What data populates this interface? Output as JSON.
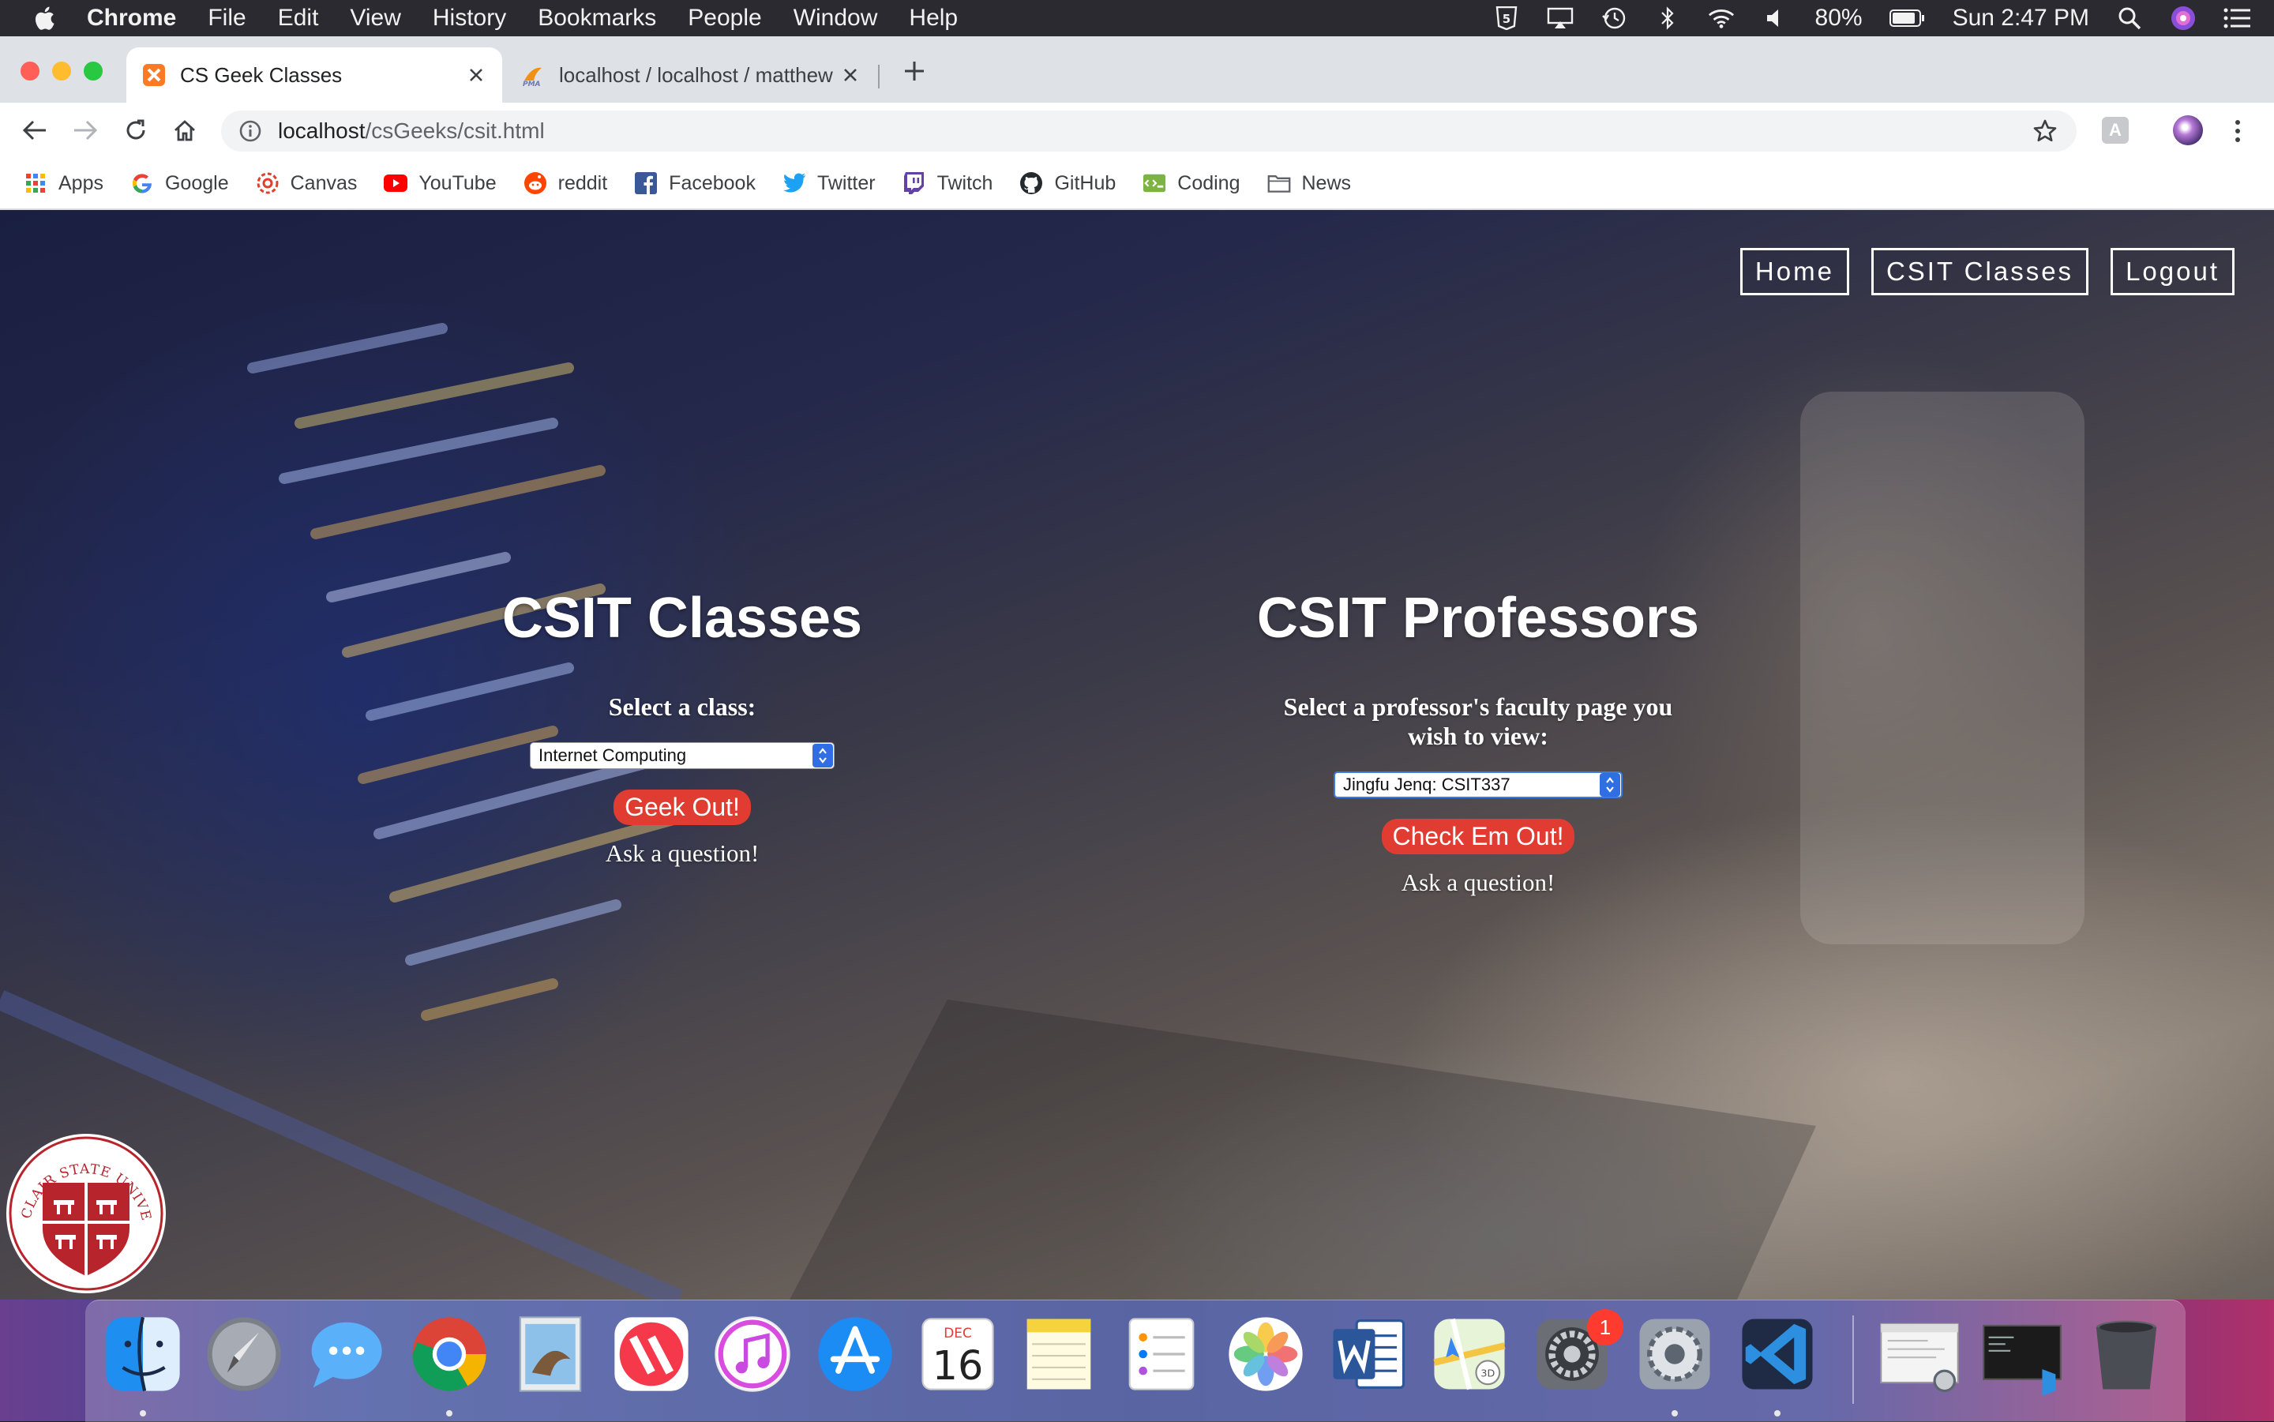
{
  "menubar": {
    "app_name": "Chrome",
    "items": [
      "File",
      "Edit",
      "View",
      "History",
      "Bookmarks",
      "People",
      "Window",
      "Help"
    ],
    "battery": "80%",
    "clock": "Sun 2:47 PM"
  },
  "tabs": [
    {
      "title": "CS Geek Classes",
      "active": true
    },
    {
      "title": "localhost / localhost / matthew",
      "active": false
    }
  ],
  "address_bar": {
    "host": "localhost",
    "path": "/csGeeks/csit.html"
  },
  "bookmarks": [
    "Apps",
    "Google",
    "Canvas",
    "YouTube",
    "reddit",
    "Facebook",
    "Twitter",
    "Twitch",
    "GitHub",
    "Coding",
    "News"
  ],
  "site_nav": {
    "home": "Home",
    "classes": "CSIT Classes",
    "logout": "Logout"
  },
  "classes_section": {
    "heading": "CSIT Classes",
    "prompt": "Select a class:",
    "selected": "Internet Computing",
    "button": "Geek Out!",
    "ask": "Ask a question!"
  },
  "professors_section": {
    "heading": "CSIT Professors",
    "prompt": "Select a professor's faculty page you wish to view:",
    "selected": "Jingfu Jenq: CSIT337",
    "button": "Check Em Out!",
    "ask": "Ask a question!"
  },
  "seal": {
    "text": "MONTCLAIR STATE UNIVERSITY",
    "color": "#b8242c"
  },
  "dock": {
    "calendar_month": "DEC",
    "calendar_day": "16",
    "notification_badge": "1"
  },
  "colors": {
    "action_button": "#e03c31",
    "select_accent": "#2f6fe3"
  }
}
